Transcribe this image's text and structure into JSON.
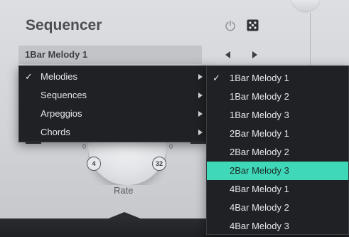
{
  "header": {
    "title": "Sequencer",
    "power_icon": "power-icon",
    "dice_icon": "dice-icon"
  },
  "preset": {
    "current": "1Bar Melody 1",
    "prev_icon": "triangle-left-icon",
    "next_icon": "triangle-right-icon"
  },
  "knob": {
    "label": "Rate",
    "min_badge": "4",
    "max_badge": "32",
    "tick_left": "0",
    "tick_right": "0"
  },
  "category_menu": {
    "items": [
      {
        "label": "Melodies",
        "checked": true,
        "has_submenu": true
      },
      {
        "label": "Sequences",
        "checked": false,
        "has_submenu": true
      },
      {
        "label": "Arpeggios",
        "checked": false,
        "has_submenu": true
      },
      {
        "label": "Chords",
        "checked": false,
        "has_submenu": true
      }
    ]
  },
  "preset_menu": {
    "items": [
      {
        "label": "1Bar Melody 1",
        "checked": true
      },
      {
        "label": "1Bar Melody 2",
        "checked": false
      },
      {
        "label": "1Bar Melody 3",
        "checked": false
      },
      {
        "label": "2Bar Melody 1",
        "checked": false
      },
      {
        "label": "2Bar Melody 2",
        "checked": false
      },
      {
        "label": "2Bar Melody 3",
        "checked": false,
        "highlighted": true
      },
      {
        "label": "4Bar Melody 1",
        "checked": false
      },
      {
        "label": "4Bar Melody 2",
        "checked": false
      },
      {
        "label": "4Bar Melody 3",
        "checked": false
      }
    ],
    "highlight_color": "#3fd8b8"
  },
  "menu_glyphs": {
    "check": "✓"
  }
}
